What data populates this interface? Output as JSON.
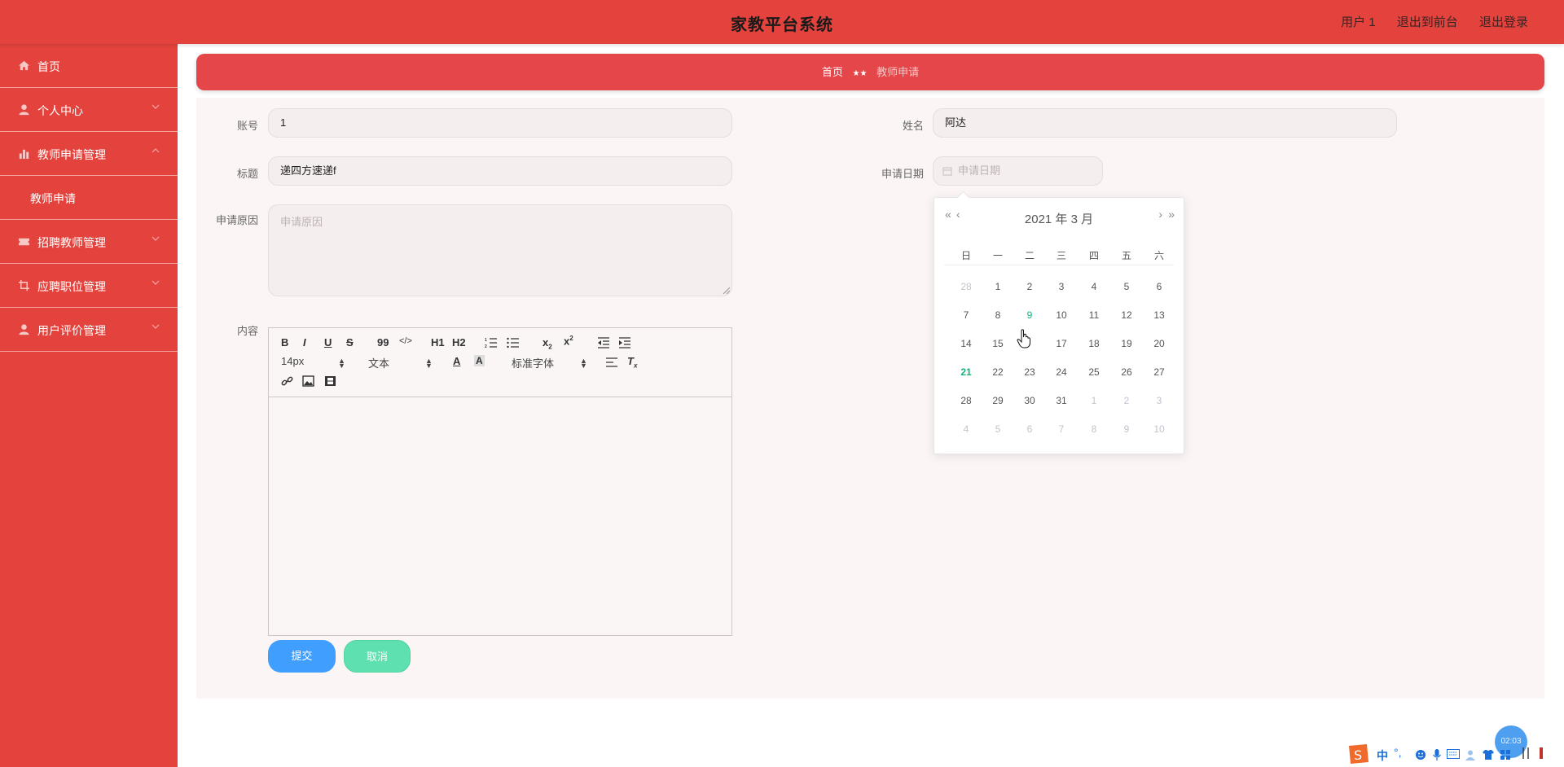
{
  "header": {
    "title": "家教平台系统",
    "links": [
      "用户 1",
      "退出到前台",
      "退出登录"
    ]
  },
  "sidebar": {
    "items": [
      {
        "label": "首页",
        "icon": "home-icon"
      },
      {
        "label": "个人中心",
        "icon": "user-icon"
      },
      {
        "label": "教师申请管理",
        "icon": "bar-chart-icon",
        "expanded": true
      },
      {
        "label": "教师申请",
        "sub": true
      },
      {
        "label": "招聘教师管理",
        "icon": "ticket-icon"
      },
      {
        "label": "应聘职位管理",
        "icon": "crop-icon"
      },
      {
        "label": "用户评价管理",
        "icon": "user-icon"
      }
    ]
  },
  "breadcrumb": {
    "home": "首页",
    "separator": "★★",
    "current": "教师申请"
  },
  "form": {
    "account_label": "账号",
    "account_value": "1",
    "name_label": "姓名",
    "name_value": "阿达",
    "title_label": "标题",
    "title_value": "递四方速递f",
    "date_label": "申请日期",
    "date_placeholder": "申请日期",
    "reason_label": "申请原因",
    "reason_placeholder": "申请原因",
    "content_label": "内容"
  },
  "editor": {
    "font_size": "14px",
    "header_select": "文本",
    "font_family": "标准字体",
    "buttons": {
      "bold": "B",
      "italic": "I",
      "underline": "U",
      "strike": "S",
      "quote": "99",
      "code": "</>",
      "h1": "H1",
      "h2": "H2"
    }
  },
  "buttons": {
    "submit": "提交",
    "cancel": "取消"
  },
  "calendar": {
    "header": "2021 年  3 月",
    "prev_year": "«",
    "prev_month": "‹",
    "next_month": "›",
    "next_year": "»",
    "weekdays": [
      "日",
      "一",
      "二",
      "三",
      "四",
      "五",
      "六"
    ],
    "weeks": [
      [
        {
          "d": "28",
          "m": "prev"
        },
        {
          "d": "1"
        },
        {
          "d": "2"
        },
        {
          "d": "3"
        },
        {
          "d": "4"
        },
        {
          "d": "5"
        },
        {
          "d": "6"
        }
      ],
      [
        {
          "d": "7"
        },
        {
          "d": "8"
        },
        {
          "d": "9",
          "state": "selected"
        },
        {
          "d": "10"
        },
        {
          "d": "11"
        },
        {
          "d": "12"
        },
        {
          "d": "13"
        }
      ],
      [
        {
          "d": "14"
        },
        {
          "d": "15"
        },
        {
          "d": "16",
          "hidden": true
        },
        {
          "d": "17"
        },
        {
          "d": "18"
        },
        {
          "d": "19"
        },
        {
          "d": "20"
        }
      ],
      [
        {
          "d": "21",
          "state": "today"
        },
        {
          "d": "22"
        },
        {
          "d": "23"
        },
        {
          "d": "24"
        },
        {
          "d": "25"
        },
        {
          "d": "26"
        },
        {
          "d": "27"
        }
      ],
      [
        {
          "d": "28"
        },
        {
          "d": "29"
        },
        {
          "d": "30"
        },
        {
          "d": "31"
        },
        {
          "d": "1",
          "m": "next"
        },
        {
          "d": "2",
          "m": "next"
        },
        {
          "d": "3",
          "m": "next"
        }
      ],
      [
        {
          "d": "4",
          "m": "next"
        },
        {
          "d": "5",
          "m": "next"
        },
        {
          "d": "6",
          "m": "next"
        },
        {
          "d": "7",
          "m": "next"
        },
        {
          "d": "8",
          "m": "next"
        },
        {
          "d": "9",
          "m": "next"
        },
        {
          "d": "10",
          "m": "next"
        }
      ]
    ]
  },
  "taskbar": {
    "clock": "02:03",
    "ime_label": "中"
  },
  "colors": {
    "brand": "#e4433d",
    "accent_blue": "#409eff",
    "accent_green": "#5ee0b0",
    "today": "#13b374"
  }
}
